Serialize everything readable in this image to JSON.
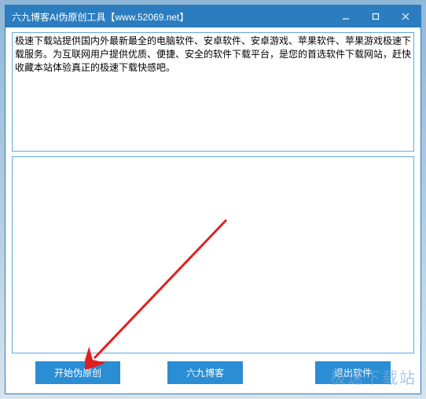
{
  "titlebar": {
    "title": "六九博客AI伪原创工具【www.52069.net】"
  },
  "textareas": {
    "input_text": "极速下载站提供国内外最新最全的电脑软件、安卓软件、安卓游戏、苹果软件、苹果游戏极速下载服务。为互联网用户提供优质、便捷、安全的软件下载平台，是您的首选软件下载网站，赶快收藏本站体验真正的极速下载快感吧。",
    "output_text": ""
  },
  "buttons": {
    "start": "开始伪原创",
    "blog": "六九博客",
    "exit": "退出软件"
  },
  "watermark": "极速下载站"
}
